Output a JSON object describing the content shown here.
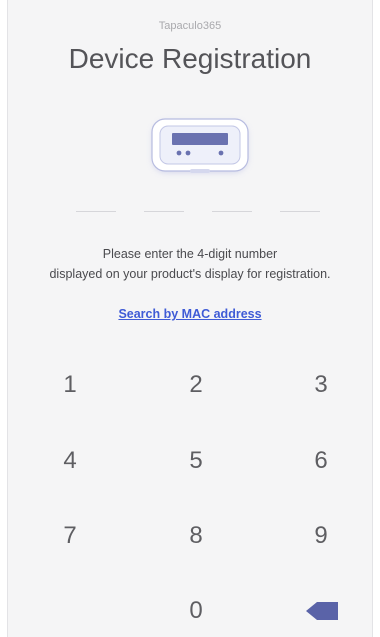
{
  "header": {
    "app_name": "Tapaculo365",
    "title": "Device Registration"
  },
  "device_icon": "device-display-icon",
  "instruction": {
    "line1": "Please enter the 4-digit number",
    "line2": "displayed on your product's display for registration."
  },
  "mac_link": "Search by MAC address",
  "keypad": {
    "keys": [
      "1",
      "2",
      "3",
      "4",
      "5",
      "6",
      "7",
      "8",
      "9",
      "0"
    ],
    "backspace_icon": "backspace-icon"
  },
  "colors": {
    "background": "#f5f5f6",
    "text": "#545458",
    "link": "#3f5bd6",
    "accent": "#5a63a8"
  }
}
